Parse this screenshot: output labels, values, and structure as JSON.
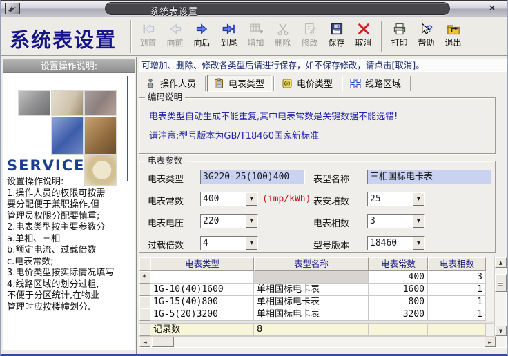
{
  "window": {
    "title": "系统表设置"
  },
  "icons": {
    "close": "✕",
    "combo_arrow": "▼",
    "scroll_up": "▲",
    "scroll_down": "▼",
    "scroll_left": "◄",
    "scroll_right": "►"
  },
  "colors": {
    "accent_navy": "#16168a",
    "notice_text": "#1d2c72",
    "warn_red": "#c41414",
    "field_bg": "#c9d3f1",
    "footer_row_bg": "#f8f6d8",
    "grid_header_text": "#1b1b8a"
  },
  "header": {
    "title": "系统表设置"
  },
  "toolbar": {
    "items": [
      {
        "label": "到首",
        "enabled": false
      },
      {
        "label": "向前",
        "enabled": false
      },
      {
        "label": "向后",
        "enabled": true
      },
      {
        "label": "到尾",
        "enabled": true
      },
      {
        "label": "增加",
        "enabled": false
      },
      {
        "label": "删除",
        "enabled": false
      },
      {
        "label": "修改",
        "enabled": false
      },
      {
        "label": "保存",
        "enabled": true
      },
      {
        "label": "取消",
        "enabled": true
      },
      {
        "label": "打印",
        "enabled": true
      },
      {
        "label": "帮助",
        "enabled": true
      },
      {
        "label": "退出",
        "enabled": true
      }
    ]
  },
  "sidebar": {
    "header": "设置操作说明:",
    "service_text": "SERVICE",
    "collage": [
      "tools-photo",
      "pen-photo",
      "knife-photo",
      "keyboard-photo",
      "hands-photo",
      "watch-photo"
    ],
    "instructions": [
      "设置操作说明:",
      "1.操作人员的权限可按需",
      "要分配便于兼职操作,但",
      "管理员权限分配要慎重;",
      "2.电表类型按主要参数分",
      " a.单相、三相",
      " b.额定电流、过载倍数",
      " c.电表常数;",
      "3.电价类型按实际情况填写",
      "4.线路区域的划分过粗,",
      "不便于分区统计,在物业",
      "管理时应按楼幢划分."
    ]
  },
  "notice": "可增加、删除、修改各类型后请进行保存，如不保存修改，请点击[取消]。",
  "tabs": [
    {
      "label": "操作人员",
      "active": false
    },
    {
      "label": "电表类型",
      "active": true
    },
    {
      "label": "电价类型",
      "active": false
    },
    {
      "label": "线路区域",
      "active": false
    }
  ],
  "coding_box": {
    "title": "编码说明",
    "lines": [
      "电表类型自动生成不能重复,其中电表常数是关键数据不能选错!",
      "请注意:型号版本为GB/T18460国家新标准"
    ]
  },
  "params_box": {
    "title": "电表参数",
    "fields": [
      {
        "label": "电表类型",
        "value": "3G220-25(100)400",
        "type": "text"
      },
      {
        "label": "表型名称",
        "value": "三相国标电卡表",
        "type": "text"
      },
      {
        "label": "电表常数",
        "value": "400",
        "type": "combo",
        "suffix": "(imp/kWh)"
      },
      {
        "label": "表安培数",
        "value": "25",
        "type": "combo"
      },
      {
        "label": "电表电压",
        "value": "220",
        "type": "combo"
      },
      {
        "label": "电表相数",
        "value": "3",
        "type": "combo"
      },
      {
        "label": "过载倍数",
        "value": "4",
        "type": "combo"
      },
      {
        "label": "型号版本",
        "value": "18460",
        "type": "combo"
      }
    ]
  },
  "grid": {
    "columns": [
      "电表类型",
      "表型名称",
      "电表常数",
      "电表相数"
    ],
    "new_row": {
      "marker": "*",
      "meter_type": "",
      "constant": "400",
      "phases": "3"
    },
    "rows": [
      [
        "1G-10(40)1600",
        "单相国标电卡表",
        "1600",
        "1"
      ],
      [
        "1G-15(40)800",
        "单相国标电卡表",
        "800",
        "1"
      ],
      [
        "1G-5(20)3200",
        "单相国标电卡表",
        "3200",
        "1"
      ]
    ],
    "footer": {
      "label": "记录数",
      "value": "8"
    }
  }
}
